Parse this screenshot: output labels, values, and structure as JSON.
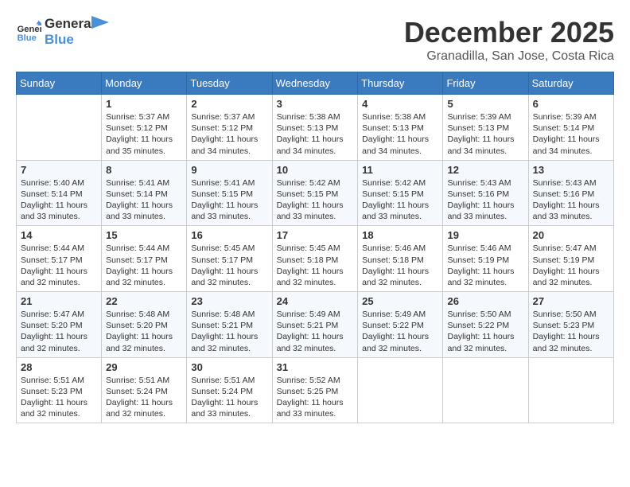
{
  "header": {
    "logo_line1": "General",
    "logo_line2": "Blue",
    "month": "December 2025",
    "location": "Granadilla, San Jose, Costa Rica"
  },
  "weekdays": [
    "Sunday",
    "Monday",
    "Tuesday",
    "Wednesday",
    "Thursday",
    "Friday",
    "Saturday"
  ],
  "weeks": [
    [
      {
        "day": "",
        "info": ""
      },
      {
        "day": "1",
        "info": "Sunrise: 5:37 AM\nSunset: 5:12 PM\nDaylight: 11 hours\nand 35 minutes."
      },
      {
        "day": "2",
        "info": "Sunrise: 5:37 AM\nSunset: 5:12 PM\nDaylight: 11 hours\nand 34 minutes."
      },
      {
        "day": "3",
        "info": "Sunrise: 5:38 AM\nSunset: 5:13 PM\nDaylight: 11 hours\nand 34 minutes."
      },
      {
        "day": "4",
        "info": "Sunrise: 5:38 AM\nSunset: 5:13 PM\nDaylight: 11 hours\nand 34 minutes."
      },
      {
        "day": "5",
        "info": "Sunrise: 5:39 AM\nSunset: 5:13 PM\nDaylight: 11 hours\nand 34 minutes."
      },
      {
        "day": "6",
        "info": "Sunrise: 5:39 AM\nSunset: 5:14 PM\nDaylight: 11 hours\nand 34 minutes."
      }
    ],
    [
      {
        "day": "7",
        "info": "Sunrise: 5:40 AM\nSunset: 5:14 PM\nDaylight: 11 hours\nand 33 minutes."
      },
      {
        "day": "8",
        "info": "Sunrise: 5:41 AM\nSunset: 5:14 PM\nDaylight: 11 hours\nand 33 minutes."
      },
      {
        "day": "9",
        "info": "Sunrise: 5:41 AM\nSunset: 5:15 PM\nDaylight: 11 hours\nand 33 minutes."
      },
      {
        "day": "10",
        "info": "Sunrise: 5:42 AM\nSunset: 5:15 PM\nDaylight: 11 hours\nand 33 minutes."
      },
      {
        "day": "11",
        "info": "Sunrise: 5:42 AM\nSunset: 5:15 PM\nDaylight: 11 hours\nand 33 minutes."
      },
      {
        "day": "12",
        "info": "Sunrise: 5:43 AM\nSunset: 5:16 PM\nDaylight: 11 hours\nand 33 minutes."
      },
      {
        "day": "13",
        "info": "Sunrise: 5:43 AM\nSunset: 5:16 PM\nDaylight: 11 hours\nand 33 minutes."
      }
    ],
    [
      {
        "day": "14",
        "info": "Sunrise: 5:44 AM\nSunset: 5:17 PM\nDaylight: 11 hours\nand 32 minutes."
      },
      {
        "day": "15",
        "info": "Sunrise: 5:44 AM\nSunset: 5:17 PM\nDaylight: 11 hours\nand 32 minutes."
      },
      {
        "day": "16",
        "info": "Sunrise: 5:45 AM\nSunset: 5:17 PM\nDaylight: 11 hours\nand 32 minutes."
      },
      {
        "day": "17",
        "info": "Sunrise: 5:45 AM\nSunset: 5:18 PM\nDaylight: 11 hours\nand 32 minutes."
      },
      {
        "day": "18",
        "info": "Sunrise: 5:46 AM\nSunset: 5:18 PM\nDaylight: 11 hours\nand 32 minutes."
      },
      {
        "day": "19",
        "info": "Sunrise: 5:46 AM\nSunset: 5:19 PM\nDaylight: 11 hours\nand 32 minutes."
      },
      {
        "day": "20",
        "info": "Sunrise: 5:47 AM\nSunset: 5:19 PM\nDaylight: 11 hours\nand 32 minutes."
      }
    ],
    [
      {
        "day": "21",
        "info": "Sunrise: 5:47 AM\nSunset: 5:20 PM\nDaylight: 11 hours\nand 32 minutes."
      },
      {
        "day": "22",
        "info": "Sunrise: 5:48 AM\nSunset: 5:20 PM\nDaylight: 11 hours\nand 32 minutes."
      },
      {
        "day": "23",
        "info": "Sunrise: 5:48 AM\nSunset: 5:21 PM\nDaylight: 11 hours\nand 32 minutes."
      },
      {
        "day": "24",
        "info": "Sunrise: 5:49 AM\nSunset: 5:21 PM\nDaylight: 11 hours\nand 32 minutes."
      },
      {
        "day": "25",
        "info": "Sunrise: 5:49 AM\nSunset: 5:22 PM\nDaylight: 11 hours\nand 32 minutes."
      },
      {
        "day": "26",
        "info": "Sunrise: 5:50 AM\nSunset: 5:22 PM\nDaylight: 11 hours\nand 32 minutes."
      },
      {
        "day": "27",
        "info": "Sunrise: 5:50 AM\nSunset: 5:23 PM\nDaylight: 11 hours\nand 32 minutes."
      }
    ],
    [
      {
        "day": "28",
        "info": "Sunrise: 5:51 AM\nSunset: 5:23 PM\nDaylight: 11 hours\nand 32 minutes."
      },
      {
        "day": "29",
        "info": "Sunrise: 5:51 AM\nSunset: 5:24 PM\nDaylight: 11 hours\nand 32 minutes."
      },
      {
        "day": "30",
        "info": "Sunrise: 5:51 AM\nSunset: 5:24 PM\nDaylight: 11 hours\nand 33 minutes."
      },
      {
        "day": "31",
        "info": "Sunrise: 5:52 AM\nSunset: 5:25 PM\nDaylight: 11 hours\nand 33 minutes."
      },
      {
        "day": "",
        "info": ""
      },
      {
        "day": "",
        "info": ""
      },
      {
        "day": "",
        "info": ""
      }
    ]
  ]
}
